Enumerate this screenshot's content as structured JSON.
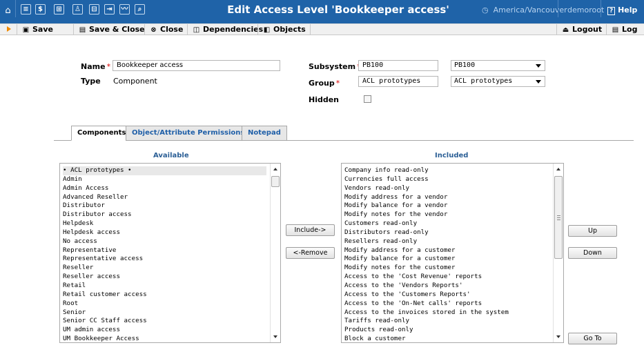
{
  "header": {
    "title": "Edit Access Level 'Bookkeeper access'",
    "timezone": "America/Vancouver",
    "user": "demoroot",
    "help_label": "Help"
  },
  "toolbar": {
    "save_label": "Save",
    "save_close_label": "Save & Close",
    "close_label": "Close",
    "dependencies_label": "Dependencies",
    "objects_label": "Objects",
    "logout_label": "Logout",
    "log_label": "Log"
  },
  "form": {
    "name_label": "Name",
    "name_value": "Bookkeeper access",
    "type_label": "Type",
    "type_value": "Component",
    "subsystem_label": "Subsystem",
    "subsystem_value": "PB100",
    "subsystem_select": "PB100",
    "group_label": "Group",
    "group_value": "ACL prototypes",
    "group_select": "ACL prototypes",
    "hidden_label": "Hidden",
    "required_mark": "*"
  },
  "tabs": [
    {
      "label": "Components",
      "active": true
    },
    {
      "label": "Object/Attribute Permissions",
      "active": false
    },
    {
      "label": "Notepad",
      "active": false
    }
  ],
  "available": {
    "heading": "Available",
    "items": [
      "• ACL prototypes •",
      "Admin",
      "Admin Access",
      "Advanced Reseller",
      "Distributor",
      "Distributor access",
      "Helpdesk",
      "Helpdesk access",
      "No access",
      "Representative",
      "Representative access",
      "Reseller",
      "Reseller access",
      "Retail",
      "Retail customer access",
      "Root",
      "Senior",
      "Senior CC Staff access",
      "UM admin access",
      "UM Bookkeeper Access"
    ]
  },
  "included": {
    "heading": "Included",
    "items": [
      "Company info read-only",
      "Currencies full access",
      "Vendors read-only",
      "Modify address for a vendor",
      "Modify balance for a vendor",
      "Modify notes for the vendor",
      "Customers read-only",
      "Distributors read-only",
      "Resellers read-only",
      "Modify address for a customer",
      "Modify balance for a customer",
      "Modify notes for the customer",
      "Access to the 'Cost Revenue' reports",
      "Access to the 'Vendors Reports'",
      "Access to the 'Customers Reports'",
      "Access to the 'On-Net calls' reports",
      "Access to the invoices stored in the system",
      "Tariffs read-only",
      "Products read-only",
      "Block a customer"
    ]
  },
  "buttons": {
    "include": "Include->",
    "remove": "<-Remove",
    "up": "Up",
    "down": "Down",
    "goto": "Go To"
  },
  "colors": {
    "header_bg": "#1f63a8",
    "link_blue": "#1f5fa8",
    "required_red": "#dd0000",
    "accent_orange": "#f08a00"
  }
}
